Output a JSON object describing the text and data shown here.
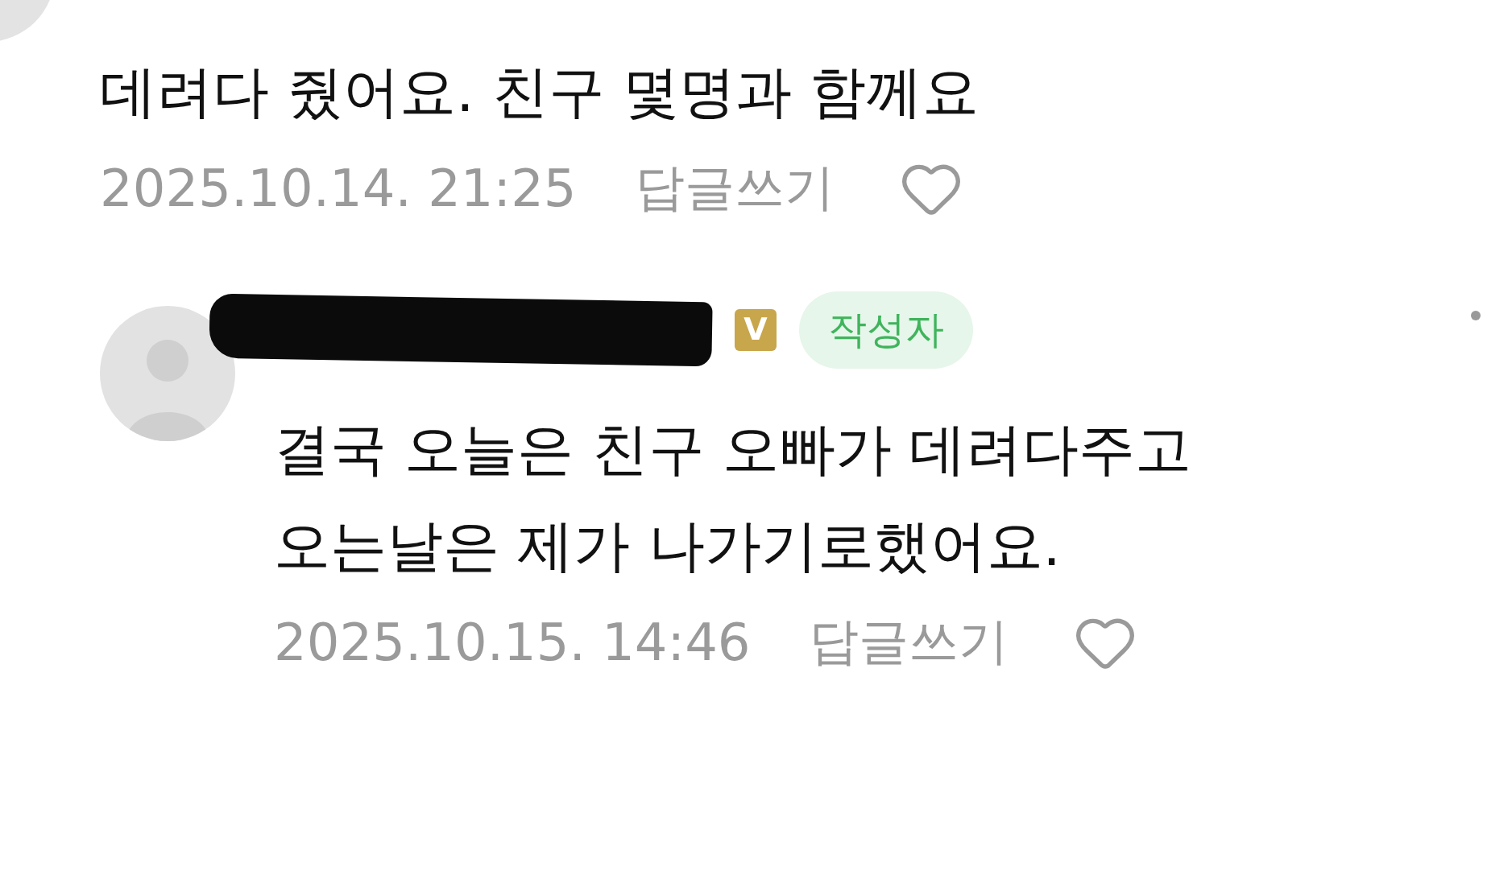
{
  "comments": [
    {
      "kind": "plain",
      "body": [
        "데려다 줬어요. 친구 몇명과 함께요"
      ],
      "date": "2025.10.14. 21:25",
      "reply": "답글쓰기",
      "liked": false
    },
    {
      "kind": "with_header",
      "author_badge": "V",
      "author_tag": "작성자",
      "name_redacted": true,
      "body": [
        "결국 오늘은 친구 오빠가 데려다주고",
        "오는날은 제가 나가기로했어요."
      ],
      "date": "2025.10.15. 14:46",
      "reply": "답글쓰기",
      "liked": false
    }
  ]
}
